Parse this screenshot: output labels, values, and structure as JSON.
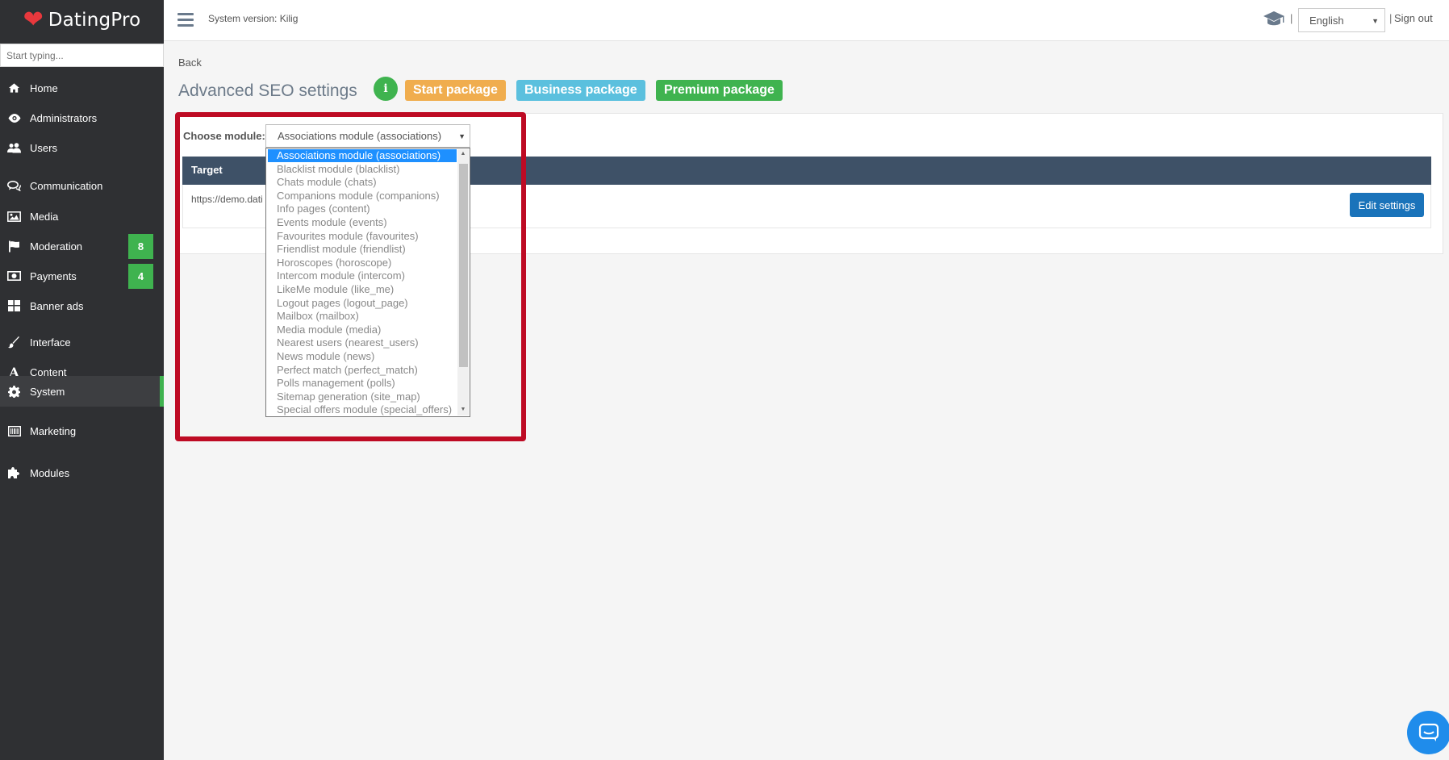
{
  "brand": {
    "name": "DatingPro",
    "heart_color": "#e8383d"
  },
  "sidebar": {
    "search_placeholder": "Start typing...",
    "items": [
      {
        "label": "Home",
        "icon": "home-icon"
      },
      {
        "label": "Administrators",
        "icon": "eye-icon"
      },
      {
        "label": "Users",
        "icon": "users-icon"
      },
      {
        "label": "Communication",
        "icon": "chat-bubbles-icon"
      },
      {
        "label": "Media",
        "icon": "image-icon"
      },
      {
        "label": "Moderation",
        "icon": "flag-icon",
        "badge": "8"
      },
      {
        "label": "Payments",
        "icon": "money-icon",
        "badge": "4"
      },
      {
        "label": "Banner ads",
        "icon": "grid-icon"
      },
      {
        "label": "Interface",
        "icon": "brush-icon"
      },
      {
        "label": "Content",
        "icon": "font-icon"
      },
      {
        "label": "System",
        "icon": "gear-icon",
        "active": true
      },
      {
        "label": "Marketing",
        "icon": "barcode-icon"
      },
      {
        "label": "Modules",
        "icon": "puzzle-icon"
      }
    ]
  },
  "topbar": {
    "system_version": "System version: Kilig",
    "language": "English",
    "sign_out": "Sign out",
    "separator": "|"
  },
  "main": {
    "back": "Back",
    "title": "Advanced SEO settings",
    "info_icon_glyph": "i",
    "packages": {
      "start": "Start package",
      "business": "Business package",
      "premium": "Premium package"
    },
    "choose_module_label": "Choose module:",
    "selected_module": "Associations module (associations)",
    "table": {
      "header_target": "Target",
      "row_url": "https://demo.dati",
      "edit_button": "Edit settings"
    }
  },
  "dropdown": {
    "options": [
      "Associations module (associations)",
      "Blacklist module (blacklist)",
      "Chats module (chats)",
      "Companions module (companions)",
      "Info pages (content)",
      "Events module (events)",
      "Favourites module (favourites)",
      "Friendlist module (friendlist)",
      "Horoscopes (horoscope)",
      "Intercom module (intercom)",
      "LikeMe module (like_me)",
      "Logout pages (logout_page)",
      "Mailbox (mailbox)",
      "Media module (media)",
      "Nearest users (nearest_users)",
      "News module (news)",
      "Perfect match (perfect_match)",
      "Polls management (polls)",
      "Sitemap generation (site_map)",
      "Special offers module (special_offers)"
    ]
  },
  "colors": {
    "sidebar_bg": "#2f3033",
    "accent_green": "#3fb34f",
    "table_header": "#3e5167",
    "edit_button": "#1a73ba",
    "highlight_border": "#be0b24",
    "start_package": "#f0ad4e",
    "business_package": "#5bc0de",
    "premium_package": "#3fb34f"
  }
}
